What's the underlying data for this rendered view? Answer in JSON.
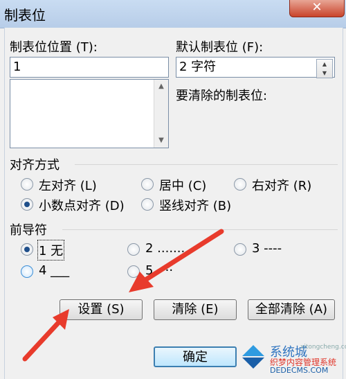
{
  "window": {
    "title": "制表位",
    "close_label": "✕"
  },
  "tab_position": {
    "label": "制表位位置 (T):",
    "value": "1"
  },
  "default_tab": {
    "label": "默认制表位 (F):",
    "value": "2 字符"
  },
  "clear_label": "要清除的制表位:",
  "alignment": {
    "label": "对齐方式",
    "options": [
      {
        "label": "左对齐 (L)",
        "selected": false
      },
      {
        "label": "居中 (C)",
        "selected": false
      },
      {
        "label": "右对齐 (R)",
        "selected": false
      },
      {
        "label": "小数点对齐 (D)",
        "selected": true
      },
      {
        "label": "竖线对齐 (B)",
        "selected": false
      }
    ]
  },
  "leader": {
    "label": "前导符",
    "options": [
      {
        "label": "1 无",
        "selected": true
      },
      {
        "label": "2 .......",
        "selected": false
      },
      {
        "label": "3 ----",
        "selected": false
      },
      {
        "label": "4 ___",
        "selected": false
      },
      {
        "label": "5 ····",
        "selected": false
      }
    ]
  },
  "buttons": {
    "set": "设置 (S)",
    "clear": "清除 (E)",
    "clear_all": "全部清除 (A)",
    "ok": "确定"
  },
  "watermark": {
    "line1": "系统城",
    "line2": "织梦内容管理系统",
    "line3": "DEDECMS.COM",
    "line4": "xitongcheng.com"
  },
  "colors": {
    "accent": "#1f4f8a",
    "arrow": "#e83b2c",
    "title_bar": "#c9dcf2"
  }
}
